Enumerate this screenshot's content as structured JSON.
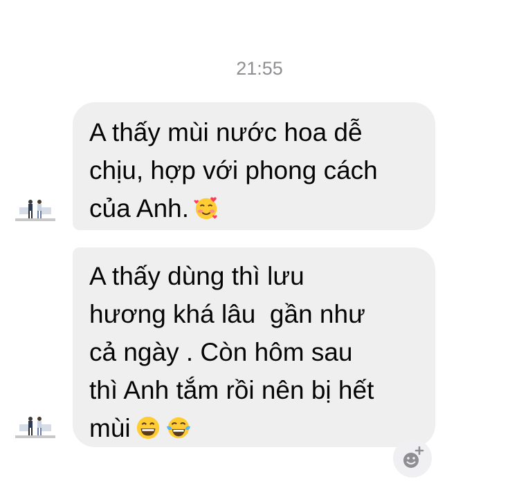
{
  "timestamp": "21:55",
  "messages": [
    {
      "text": "A thấy mùi nước hoa dễ\nchịu, hợp với phong cách\ncủa Anh.",
      "emojis": [
        "smiling-face-with-hearts"
      ]
    },
    {
      "text": "A thấy dùng thì lưu\nhương khá lâu  gần như\ncả ngày . Còn hôm sau\nthì Anh tắm rồi nên bị hết\nmùi",
      "emojis": [
        "grinning-face",
        "face-with-tears-of-joy"
      ]
    }
  ],
  "colors": {
    "bubble_bg": "#efeff0",
    "text": "#050505",
    "timestamp": "#8e8e93",
    "emoji_yellow": "#ffcc33"
  },
  "icons": {
    "avatar": "avatar-icon",
    "react": "add-reaction-icon"
  }
}
